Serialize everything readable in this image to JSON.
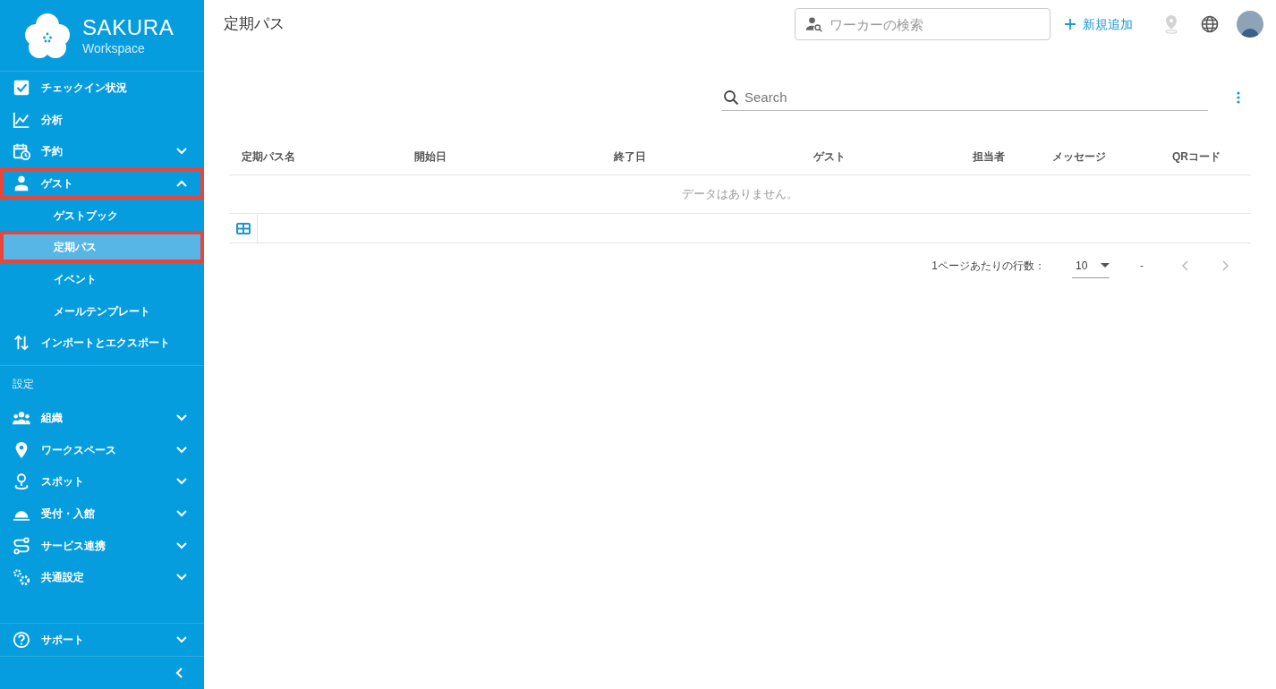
{
  "sidebar": {
    "logo": {
      "title": "SAKURA",
      "subtitle": "Workspace"
    },
    "items": [
      {
        "label": "チェックイン状況"
      },
      {
        "label": "分析"
      },
      {
        "label": "予約",
        "expanded": false
      },
      {
        "label": "ゲスト",
        "expanded": true,
        "highlighted": true,
        "children": [
          {
            "label": "ゲストブック",
            "selected": false
          },
          {
            "label": "定期パス",
            "selected": true,
            "highlighted": true
          },
          {
            "label": "イベント",
            "selected": false
          },
          {
            "label": "メールテンプレート",
            "selected": false
          }
        ]
      },
      {
        "label": "インポートとエクスポート"
      }
    ],
    "section_label": "設定",
    "settings_items": [
      {
        "label": "組織",
        "expanded": false
      },
      {
        "label": "ワークスペース",
        "expanded": false
      },
      {
        "label": "スポット",
        "expanded": false
      },
      {
        "label": "受付・入館",
        "expanded": false
      },
      {
        "label": "サービス連携",
        "expanded": false
      },
      {
        "label": "共通設定",
        "expanded": false
      }
    ],
    "support": {
      "label": "サポート",
      "expanded": false
    }
  },
  "header": {
    "title": "定期パス",
    "worker_search": {
      "placeholder": "ワーカーの検索"
    },
    "add_button": "新規追加",
    "location_disabled": true
  },
  "table": {
    "search": {
      "placeholder": "Search"
    },
    "columns": [
      "定期パス名",
      "開始日",
      "終了日",
      "ゲスト",
      "担当者",
      "メッセージ",
      "QRコード"
    ],
    "empty_message": "データはありません。",
    "pagination": {
      "rows_label": "1ページあたりの行数：",
      "rows_value": "10",
      "range": "-",
      "prev_disabled": true,
      "next_disabled": true
    }
  }
}
